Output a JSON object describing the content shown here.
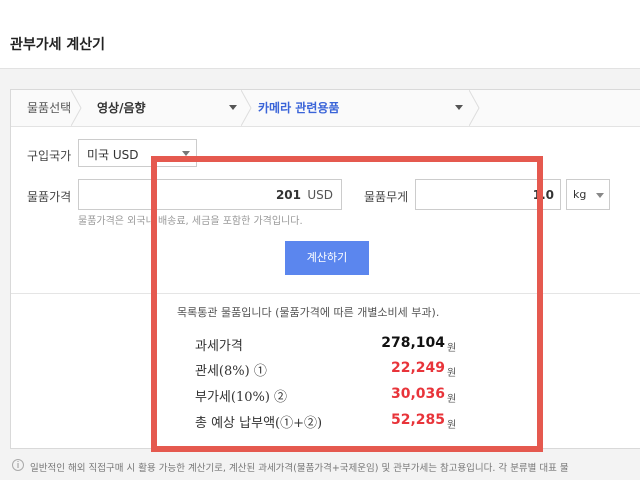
{
  "header": {
    "title": "관부가세 계산기"
  },
  "breadcrumb": {
    "root": "물품선택",
    "category": "영상/음향",
    "subcategory": "카메라 관련용품"
  },
  "form": {
    "country_label": "구입국가",
    "country_value": "미국 USD",
    "price_label": "물품가격",
    "price_value": "201",
    "price_unit": "USD",
    "weight_label": "물품무게",
    "weight_value": "1.0",
    "weight_unit": "kg",
    "price_hint": "물품가격은 외국내 배송료, 세금을 포함한 가격입니다.",
    "calc_button": "계산하기"
  },
  "result": {
    "note": "목록통관 물품입니다 (물품가격에 따른 개별소비세 부과).",
    "unit": "원",
    "rows": [
      {
        "label": "과세가격",
        "value": "278,104"
      },
      {
        "label": "관세(8%) ①",
        "value": "22,249"
      },
      {
        "label": "부가세(10%) ②",
        "value": "30,036"
      },
      {
        "label": "총 예상 납부액(①+②)",
        "value": "52,285"
      }
    ]
  },
  "footer": {
    "text": "일반적인 해외 직접구매 시 활용 가능한 계산기로, 계산된 과세가격(물품가격+국제운임) 및 관부가세는 참고용입니다. 각 분류별 대표 물"
  },
  "colors": {
    "accent": "#3a64d8",
    "button": "#5b86ee",
    "highlight": "#e5594f",
    "value_red": "#e8343a"
  }
}
